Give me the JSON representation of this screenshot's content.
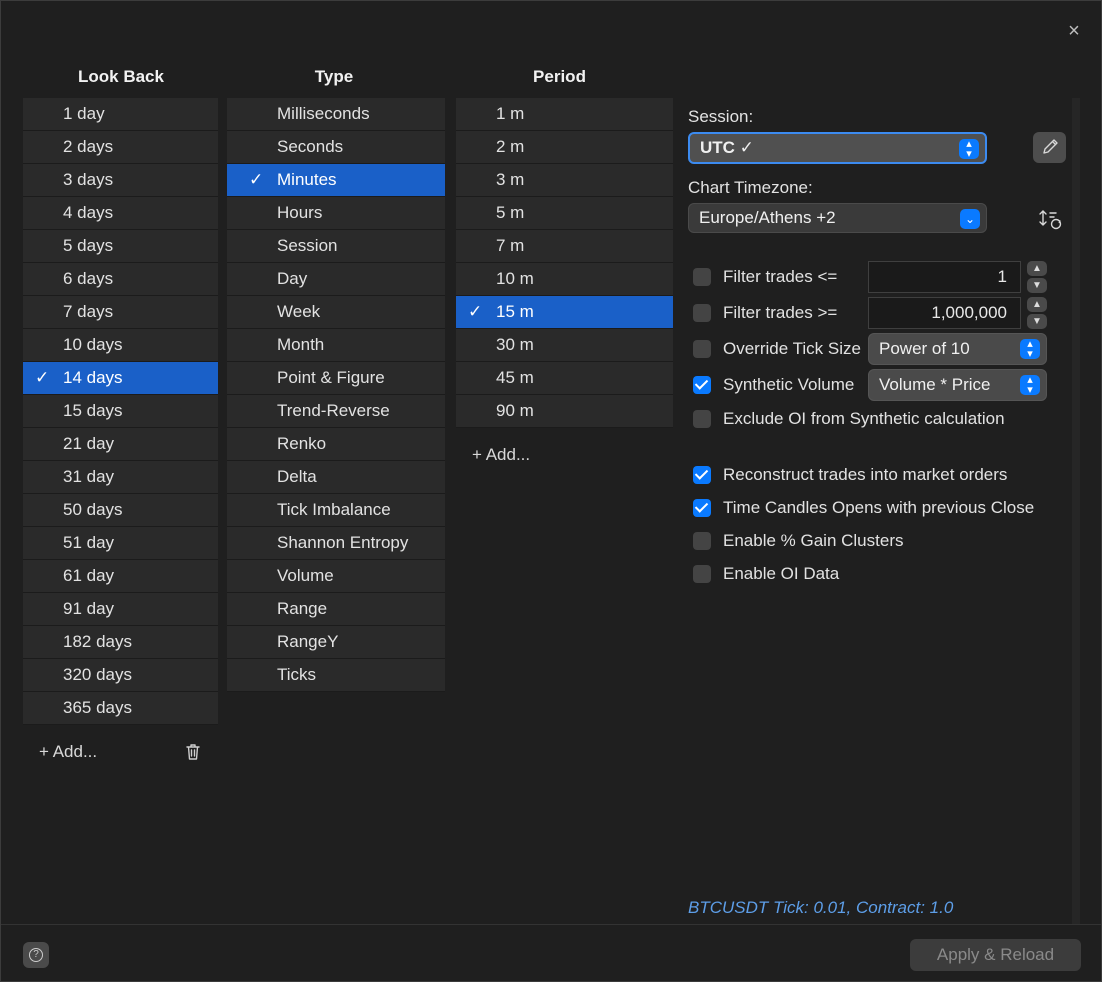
{
  "window": {
    "close_glyph": "×"
  },
  "columns": {
    "lookback": {
      "header": "Look Back",
      "items": [
        "1 day",
        "2 days",
        "3 days",
        "4 days",
        "5 days",
        "6 days",
        "7 days",
        "10 days",
        "14 days",
        "15 days",
        "21 day",
        "31 day",
        "50 days",
        "51 day",
        "61 day",
        "91 day",
        "182 days",
        "320 days",
        "365 days"
      ],
      "selected_index": 8,
      "add_label": "+ Add..."
    },
    "type": {
      "header": "Type",
      "items": [
        "Milliseconds",
        "Seconds",
        "Minutes",
        "Hours",
        "Session",
        "Day",
        "Week",
        "Month",
        "Point & Figure",
        "Trend-Reverse",
        "Renko",
        "Delta",
        "Tick Imbalance",
        "Shannon Entropy",
        "Volume",
        "Range",
        "RangeY",
        "Ticks"
      ],
      "selected_index": 2
    },
    "period": {
      "header": "Period",
      "items": [
        "1 m",
        "2 m",
        "3 m",
        "5 m",
        "7 m",
        "10 m",
        "15 m",
        "30 m",
        "45 m",
        "90 m"
      ],
      "selected_index": 6,
      "add_label": "+ Add..."
    },
    "check_glyph": "✓"
  },
  "settings": {
    "session_label": "Session:",
    "session_value": "UTC ✓",
    "timezone_label": "Chart Timezone:",
    "timezone_value": "Europe/Athens +2",
    "filter_le": {
      "label": "Filter trades <=",
      "checked": false,
      "value": "1"
    },
    "filter_ge": {
      "label": "Filter trades >=",
      "checked": false,
      "value": "1,000,000"
    },
    "override_tick": {
      "label": "Override Tick Size",
      "checked": false,
      "value": "Power of 10"
    },
    "synthetic_volume": {
      "label": "Synthetic Volume",
      "checked": true,
      "value": "Volume * Price"
    },
    "exclude_oi": {
      "label": "Exclude OI from Synthetic calculation",
      "checked": false
    },
    "reconstruct": {
      "label": "Reconstruct trades into market orders",
      "checked": true
    },
    "time_candles": {
      "label": "Time Candles Opens with previous Close",
      "checked": true
    },
    "gain_clusters": {
      "label": "Enable % Gain Clusters",
      "checked": false
    },
    "oi_data": {
      "label": "Enable OI Data",
      "checked": false
    }
  },
  "info_text": "BTCUSDT Tick: 0.01, Contract: 1.0",
  "footer": {
    "apply_label": "Apply & Reload",
    "help_glyph": "?"
  },
  "colors": {
    "accent": "#0a7aff",
    "selection": "#1a60c8",
    "info": "#5d9ee8"
  }
}
